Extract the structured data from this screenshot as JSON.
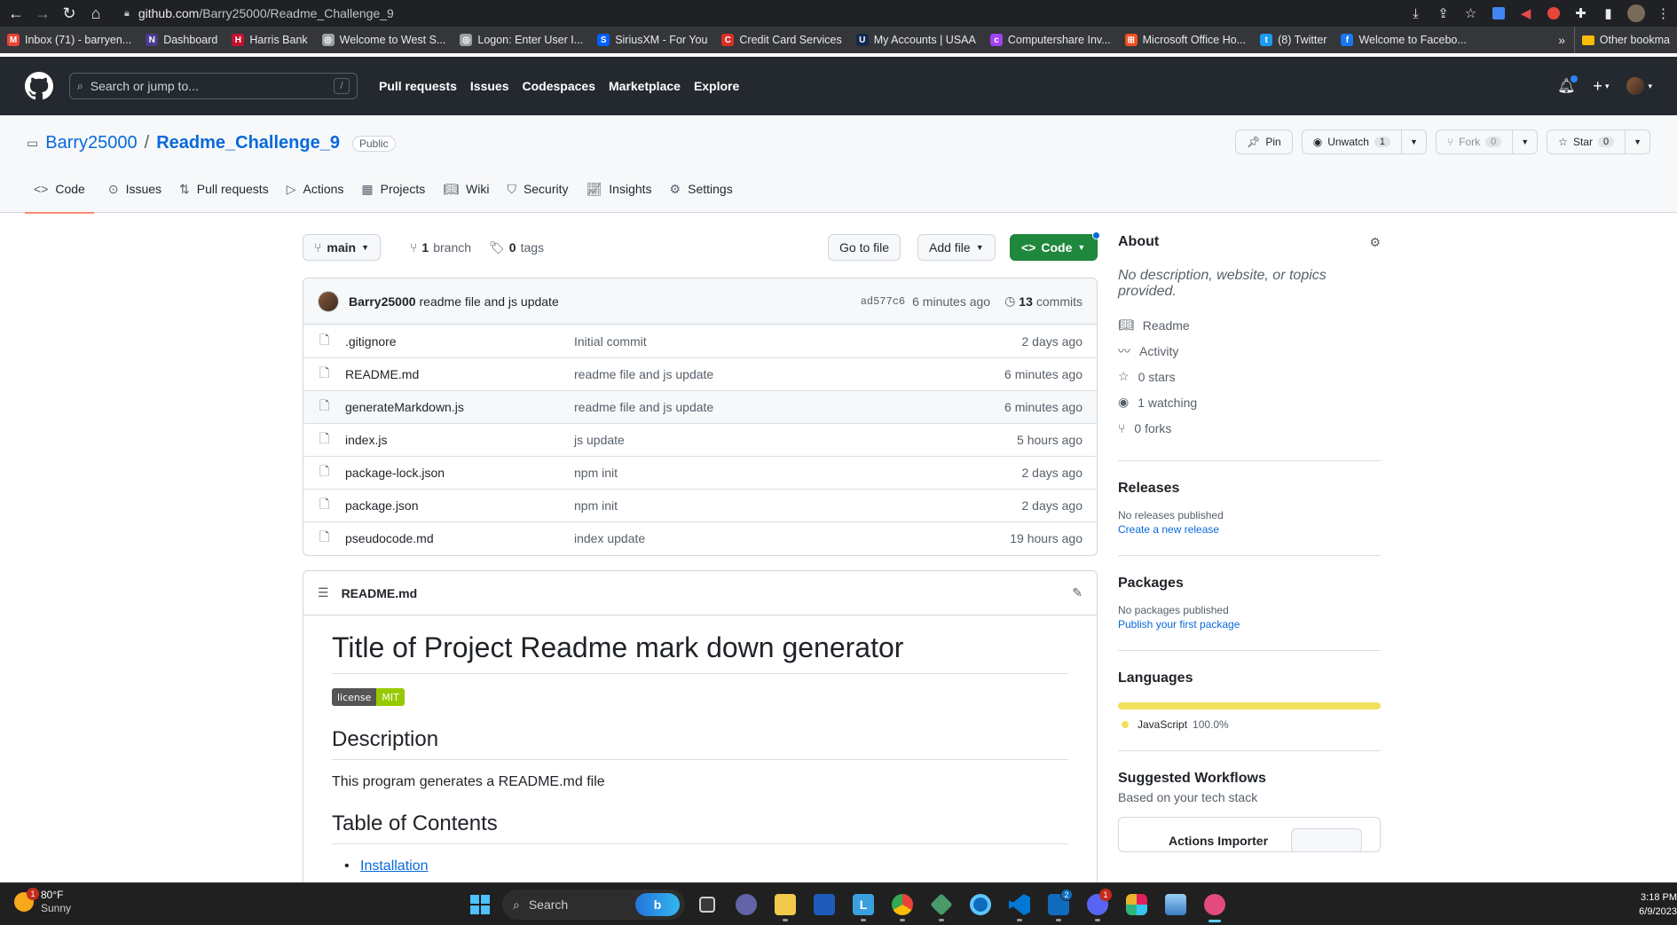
{
  "browser": {
    "url_host": "github.com",
    "url_path": "/Barry25000/Readme_Challenge_9",
    "bookmarks": [
      {
        "label": "Inbox (71) - barryen...",
        "color": "#ea4335",
        "glyph": "M"
      },
      {
        "label": "Dashboard",
        "color": "#4b3a8f",
        "glyph": "N"
      },
      {
        "label": "Harris Bank",
        "color": "#c8102e",
        "glyph": "H"
      },
      {
        "label": "Welcome to West S...",
        "color": "#9aa0a6",
        "glyph": "◎"
      },
      {
        "label": "Logon: Enter User I...",
        "color": "#9aa0a6",
        "glyph": "◎"
      },
      {
        "label": "SiriusXM - For You",
        "color": "#0060ff",
        "glyph": "S"
      },
      {
        "label": "Credit Card Services",
        "color": "#d93025",
        "glyph": "C"
      },
      {
        "label": "My Accounts | USAA",
        "color": "#12284c",
        "glyph": "U"
      },
      {
        "label": "Computershare Inv...",
        "color": "#a142f4",
        "glyph": "c"
      },
      {
        "label": "Microsoft Office Ho...",
        "color": "#f25022",
        "glyph": "⊞"
      },
      {
        "label": "(8) Twitter",
        "color": "#1d9bf0",
        "glyph": "t"
      },
      {
        "label": "Welcome to Facebo...",
        "color": "#1877f2",
        "glyph": "f"
      }
    ],
    "more": "»",
    "other_bookmarks": "Other bookma"
  },
  "github": {
    "search_placeholder": "Search or jump to...",
    "search_key": "/",
    "nav": [
      "Pull requests",
      "Issues",
      "Codespaces",
      "Marketplace",
      "Explore"
    ]
  },
  "repo": {
    "owner": "Barry25000",
    "sep": "/",
    "name": "Readme_Challenge_9",
    "visibility": "Public",
    "pin": "Pin",
    "unwatch": "Unwatch",
    "unwatch_count": "1",
    "fork": "Fork",
    "fork_count": "0",
    "star": "Star",
    "star_count": "0",
    "tabs": [
      "Code",
      "Issues",
      "Pull requests",
      "Actions",
      "Projects",
      "Wiki",
      "Security",
      "Insights",
      "Settings"
    ]
  },
  "branch": {
    "name": "main",
    "branches_count": "1",
    "branches_label": "branch",
    "tags_count": "0",
    "tags_label": "tags",
    "go_to_file": "Go to file",
    "add_file": "Add file",
    "code": "Code"
  },
  "commit": {
    "author": "Barry25000",
    "message": "readme file and js update",
    "sha": "ad577c6",
    "time": "6 minutes ago",
    "commits_count": "13",
    "commits_label": "commits"
  },
  "files": [
    {
      "name": ".gitignore",
      "message": "Initial commit",
      "age": "2 days ago"
    },
    {
      "name": "README.md",
      "message": "readme file and js update",
      "age": "6 minutes ago"
    },
    {
      "name": "generateMarkdown.js",
      "message": "readme file and js update",
      "age": "6 minutes ago"
    },
    {
      "name": "index.js",
      "message": "js update",
      "age": "5 hours ago"
    },
    {
      "name": "package-lock.json",
      "message": "npm init",
      "age": "2 days ago"
    },
    {
      "name": "package.json",
      "message": "npm init",
      "age": "2 days ago"
    },
    {
      "name": "pseudocode.md",
      "message": "index update",
      "age": "19 hours ago"
    }
  ],
  "readme": {
    "filename": "README.md",
    "h1": "Title of Project Readme mark down generator",
    "badge_left": "license",
    "badge_right": "MIT",
    "h2_description": "Description",
    "description": "This program generates a README.md file",
    "h2_toc": "Table of Contents",
    "toc_first": "Installation"
  },
  "about": {
    "title": "About",
    "description": "No description, website, or topics provided.",
    "items": [
      "Readme",
      "Activity",
      "0 stars",
      "1 watching",
      "0 forks"
    ],
    "releases_title": "Releases",
    "releases_text": "No releases published",
    "releases_link": "Create a new release",
    "packages_title": "Packages",
    "packages_text": "No packages published",
    "packages_link": "Publish your first package",
    "languages_title": "Languages",
    "language_name": "JavaScript",
    "language_pct": "100.0%",
    "language_share": 100,
    "language_color": "#f1e05a",
    "workflows_title": "Suggested Workflows",
    "workflows_sub": "Based on your tech stack",
    "workflow_first": "Actions Importer"
  },
  "taskbar": {
    "temp": "80°F",
    "weather": "Sunny",
    "weather_badge": "1",
    "search": "Search",
    "time": "3:18 PM",
    "date": "6/9/2023",
    "vscode_badge": "2",
    "discord_badge": "1"
  },
  "colors": {
    "accent": "#0969da",
    "code_button": "#1f883d",
    "header": "#24292f",
    "active_tab": "#fd8c73"
  }
}
